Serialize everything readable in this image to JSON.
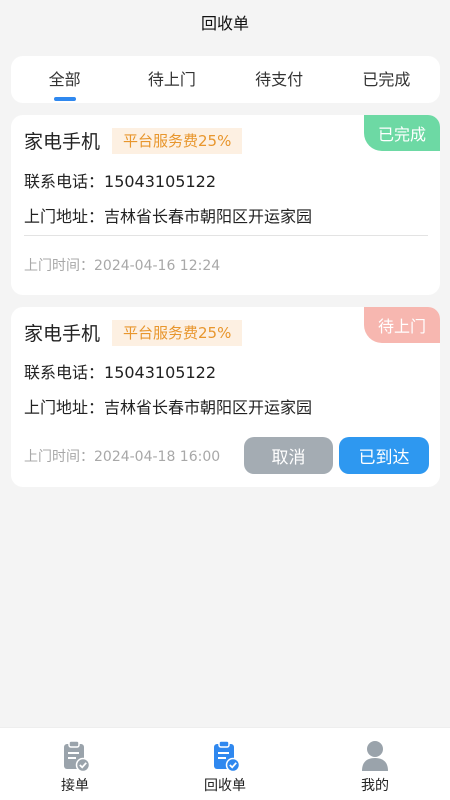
{
  "header": {
    "title": "回收单"
  },
  "tabs": [
    {
      "label": "全部",
      "active": true
    },
    {
      "label": "待上门",
      "active": false
    },
    {
      "label": "待支付",
      "active": false
    },
    {
      "label": "已完成",
      "active": false
    }
  ],
  "orders": [
    {
      "status": "已完成",
      "status_color": "#6dd9a4",
      "title": "家电手机",
      "fee": "平台服务费25%",
      "phone_label": "联系电话：",
      "phone": "15043105122",
      "address_label": "上门地址：",
      "address": "吉林省长春市朝阳区开运家园",
      "time_label": "上门时间：",
      "time": "2024-04-16 12:24"
    },
    {
      "status": "待上门",
      "status_color": "#f7b7b0",
      "title": "家电手机",
      "fee": "平台服务费25%",
      "phone_label": "联系电话：",
      "phone": "15043105122",
      "address_label": "上门地址：",
      "address": "吉林省长春市朝阳区开运家园",
      "time_label": "上门时间：",
      "time": "2024-04-18 16:00",
      "actions": {
        "cancel": "取消",
        "arrived": "已到达"
      }
    }
  ],
  "bottom_nav": [
    {
      "label": "接单",
      "icon": "clipboard-check-icon",
      "active": false
    },
    {
      "label": "回收单",
      "icon": "clipboard-check-icon",
      "active": true
    },
    {
      "label": "我的",
      "icon": "user-icon",
      "active": false
    }
  ],
  "colors": {
    "accent": "#2f88ef",
    "fee_text": "#e8962d",
    "fee_bg": "#fdf0e2",
    "nav_inactive": "#9aa3ab"
  }
}
